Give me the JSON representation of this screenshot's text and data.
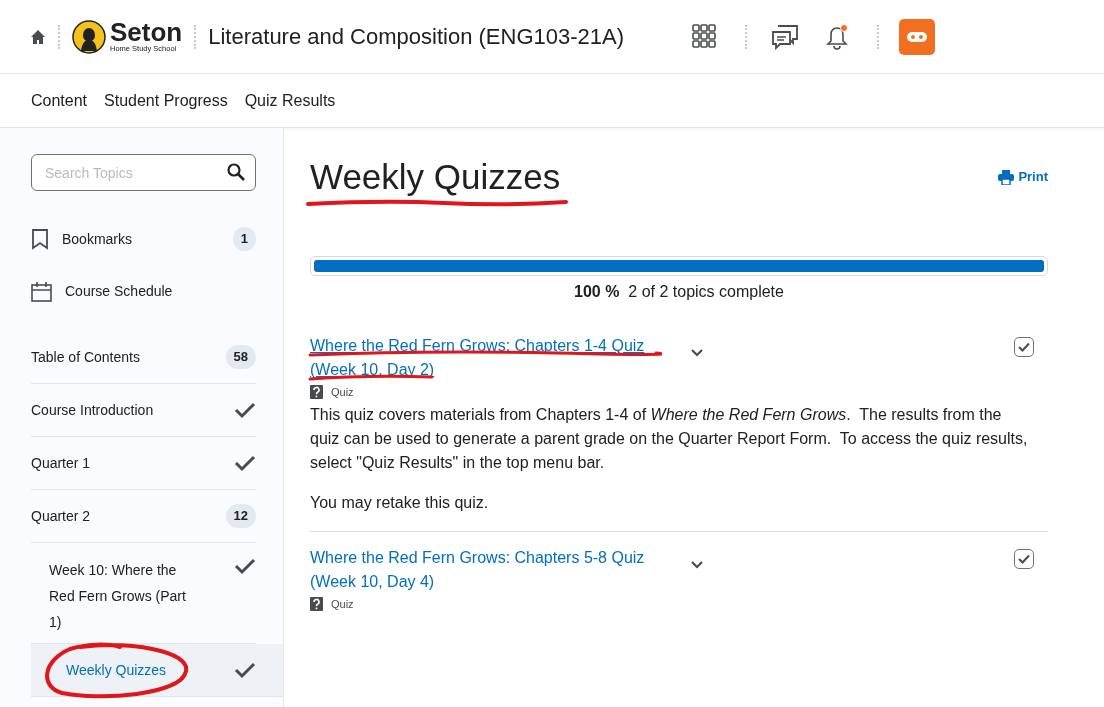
{
  "header": {
    "logo": {
      "name": "Seton",
      "tagline": "Home Study School"
    },
    "course_title": "Literature and Composition (ENG103-21A)",
    "notifications_unread": true
  },
  "nav": [
    {
      "label": "Content"
    },
    {
      "label": "Student Progress"
    },
    {
      "label": "Quiz Results"
    }
  ],
  "sidebar": {
    "search": {
      "placeholder": "Search Topics"
    },
    "shortcuts": [
      {
        "kind": "bookmark",
        "label": "Bookmarks",
        "count": "1"
      },
      {
        "kind": "calendar",
        "label": "Course Schedule"
      }
    ],
    "toc": {
      "label": "Table of Contents",
      "count": "58"
    },
    "items": [
      {
        "label": "Course Introduction",
        "completed": true,
        "selected": false
      },
      {
        "label": "Quarter 1",
        "completed": true,
        "selected": false
      },
      {
        "label": "Quarter 2",
        "count": "12",
        "completed": false,
        "selected": false,
        "children": [
          {
            "label": "Week 10: Where the Red Fern Grows (Part 1)",
            "completed": true,
            "selected": false
          },
          {
            "label": "Weekly Quizzes",
            "completed": true,
            "selected": true
          }
        ]
      }
    ]
  },
  "main": {
    "title": "Weekly Quizzes",
    "print": "Print",
    "progress": {
      "level": 1,
      "percent": "100 %",
      "summary": "2 of 2 topics complete"
    },
    "topics": [
      {
        "title": "Where the Red Fern Grows: Chapters 1-4 Quiz (Week 10, Day 2)",
        "type": "Quiz",
        "checked": true,
        "description": [
          "This quiz covers materials from Chapters 1-4 of *Where the Red Fern Grows*.  The results from the quiz can be used to generate a parent grade on the Quarter Report Form.  To access the quiz results, select \"Quiz Results\" in the top menu bar.",
          "You may retake this quiz."
        ]
      },
      {
        "title": "Where the Red Fern Grows: Chapters 5-8 Quiz (Week 10, Day 4)",
        "type": "Quiz",
        "checked": true
      }
    ]
  }
}
